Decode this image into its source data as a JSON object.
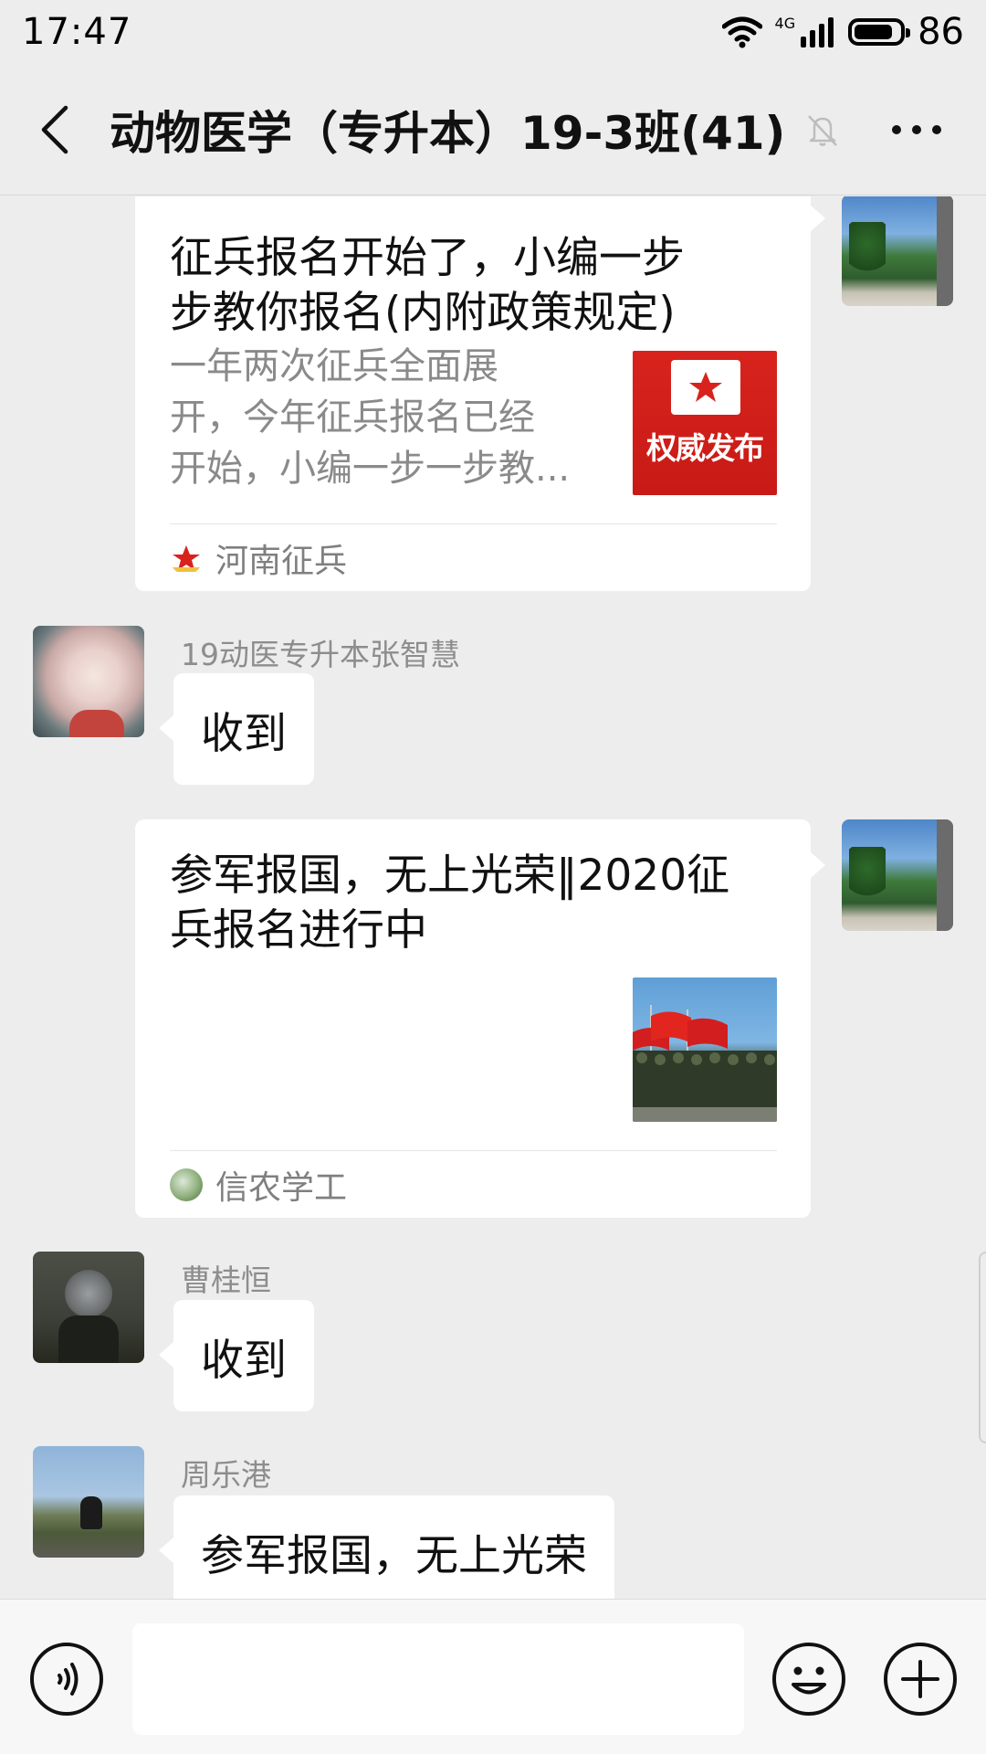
{
  "status_bar": {
    "time": "17:47",
    "network": "4G",
    "battery": "86",
    "battery_level": 0.86
  },
  "header": {
    "title": "动物医学（专升本）19-3班(41)",
    "back_icon": "back-arrow-icon",
    "mute_icon": "bell-muted-icon",
    "more_icon": "more-dots-icon"
  },
  "messages": [
    {
      "type": "article",
      "sender": "self",
      "title": "征兵报名开始了，小编一步步教你报名(内附政策规定)",
      "title_lines": [
        "征兵报名开始了，小编一步",
        "步教你报名(内附政策规定)"
      ],
      "description_lines": [
        "一年两次征兵全面展",
        "开，今年征兵报名已经",
        "开始，小编一步一步教..."
      ],
      "thumbnail_text": "权威发布",
      "source": "河南征兵"
    },
    {
      "type": "text",
      "sender_name": "19动医专升本张智慧",
      "text": "收到"
    },
    {
      "type": "article",
      "sender": "self",
      "title_lines": [
        "参军报国，无上光荣‖2020征",
        "兵报名进行中"
      ],
      "source": "信农学工"
    },
    {
      "type": "text",
      "sender_name": "曹桂恒",
      "text": "收到"
    },
    {
      "type": "text",
      "sender_name": "周乐港",
      "text": "参军报国，无上光荣"
    }
  ],
  "input_bar": {
    "voice_icon": "voice-icon",
    "emoji_icon": "emoji-icon",
    "plus_icon": "plus-icon",
    "text_value": ""
  },
  "colors": {
    "background": "#ededed",
    "bubble": "#ffffff",
    "muted_text": "#8d8d8d",
    "red_thumb": "#d8231d"
  }
}
